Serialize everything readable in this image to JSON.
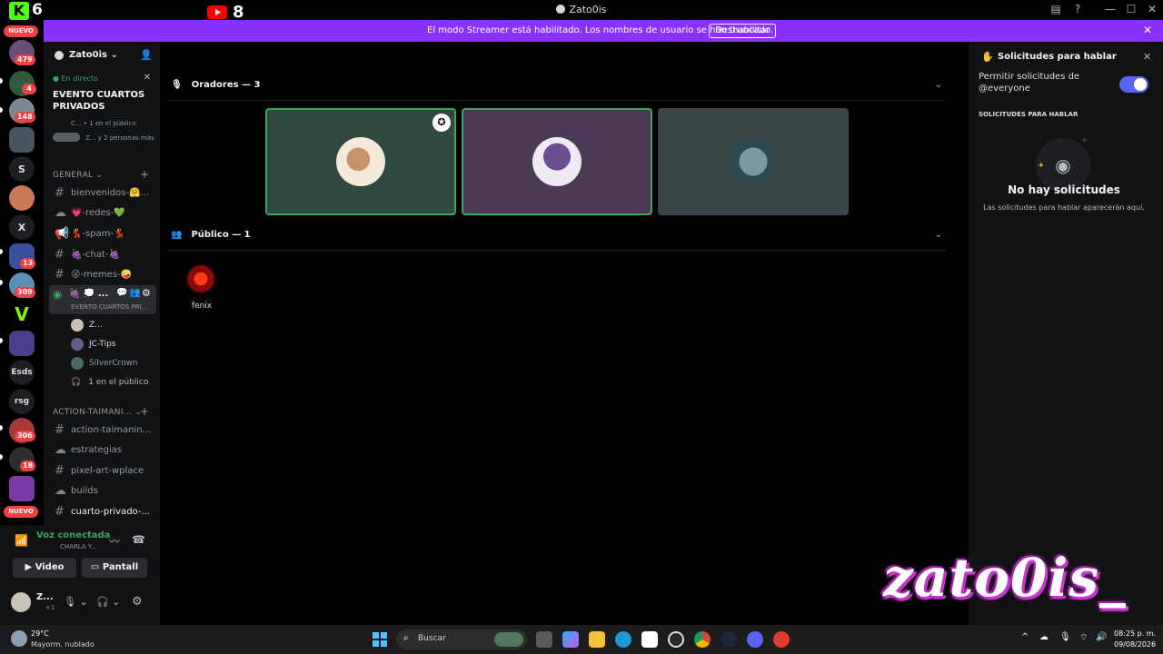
{
  "window": {
    "title": "Zato0is"
  },
  "top_widgets": {
    "k_count": "6",
    "youtube_count": "8"
  },
  "banner": {
    "text": "El modo Streamer está habilitado. Los nombres de usuario se han truncado.",
    "button": "Deshabilitar"
  },
  "server_rail": {
    "badges": [
      "479",
      "4",
      "148",
      "13",
      "309",
      "306",
      "18"
    ],
    "nuevo": "NUEVO",
    "letters": [
      "S",
      "X",
      "Esds",
      "rsg"
    ]
  },
  "channels": {
    "server_name": "Zato0is",
    "live": {
      "status": "En directo",
      "event_title": "EVENTO CUARTOS PRIVADOS",
      "meta": "C... • 1 en el público",
      "people": "Z... y 2 personas más"
    },
    "categories": [
      "GENERAL",
      "ACTION-TAIMANI..."
    ],
    "general": [
      {
        "label": "bienvenidos-🤗...",
        "icon": "hash-icon"
      },
      {
        "label": "💗-redes-💚",
        "icon": "forum-icon"
      },
      {
        "label": "💃-spam-💃",
        "icon": "megaphone-icon"
      },
      {
        "label": "🍇-chat-🍇",
        "icon": "hash-icon"
      },
      {
        "label": "😜-memes-🤪",
        "icon": "hash-icon"
      }
    ],
    "stage_channel": {
      "label": "🍇 💭 ...",
      "sub": "EVENTO CUARTOS PRI..."
    },
    "stage_users": [
      "Z...",
      "JC-Tips",
      "SilverCrown"
    ],
    "stage_audience": "1 en el público",
    "action": [
      {
        "label": "action-taimanin...",
        "icon": "hash-icon"
      },
      {
        "label": "estrategias",
        "icon": "forum-icon"
      },
      {
        "label": "pixel-art-wplace",
        "icon": "hash-icon"
      },
      {
        "label": "builds",
        "icon": "forum-icon"
      },
      {
        "label": "cuarto-privado-...",
        "icon": "hash-icon"
      }
    ]
  },
  "voice": {
    "status": "Voz conectada",
    "channel": "CHARLA Y...",
    "video_label": "Video",
    "screen_label": "Pantall",
    "user": "Z...",
    "user_sub": "+1"
  },
  "stage": {
    "speakers_header": "Oradores — 3",
    "audience_header": "Público — 1",
    "speakers": [
      {
        "bg": "#2e4a3f",
        "border": "#3ba55d"
      },
      {
        "bg": "#4a3a55",
        "border": "#3ba55d"
      },
      {
        "bg": "#3a4548",
        "border": "#3a4548"
      }
    ],
    "audience": [
      {
        "name": "fenix"
      }
    ]
  },
  "panel": {
    "title": "Solicitudes para hablar",
    "toggle_label": "Permitir solicitudes de @everyone",
    "toggle_on": true,
    "section": "SOLICITUDES PARA HABLAR",
    "empty_title": "No hay solicitudes",
    "empty_sub": "Las solicitudes para hablar aparecerán aquí."
  },
  "taskbar": {
    "weather_temp": "29°C",
    "weather_desc": "Mayorm. nublado",
    "search": "Buscar",
    "time": "08:25 p. m.",
    "date": "09/08/2026"
  },
  "overlay": {
    "text": "zato0is_"
  },
  "colors": {
    "accent": "#5865f2",
    "banner": "#8a31ff",
    "speaking": "#3ba55d",
    "live": "#3ba55d"
  }
}
